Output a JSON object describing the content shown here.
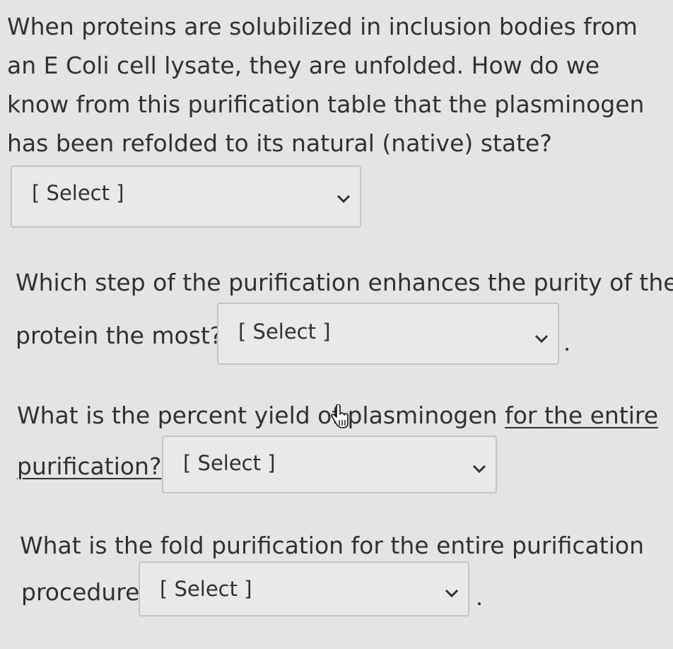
{
  "q1": {
    "text": "When proteins are solubilized in inclusion bodies from an E Coli cell lysate, they are unfolded.  How do we know from this purification table that the plasminogen has been refolded to its natural (native) state?",
    "select_value": "[ Select ]"
  },
  "q2": {
    "line1": "Which step of the purification enhances the purity of the",
    "line2": "protein the most?",
    "select_value": "[ Select ]",
    "suffix": "."
  },
  "q3": {
    "line1_a": "What is the percent yield of ",
    "line1_b": "plasminogen ",
    "line1_c": "for the entire",
    "line2": "purification?",
    "select_value": "[ Select ]"
  },
  "q4": {
    "line1": "What is the fold purification for the entire purification",
    "line2": "procedure",
    "select_value": "[ Select ]",
    "suffix": "."
  },
  "icons": {
    "dropdown": "chevron-down-icon",
    "cursor": "hand-pointer-icon"
  },
  "colors": {
    "background": "#e4e4e2",
    "text": "#2f3133",
    "border": "#c4c5c3"
  }
}
